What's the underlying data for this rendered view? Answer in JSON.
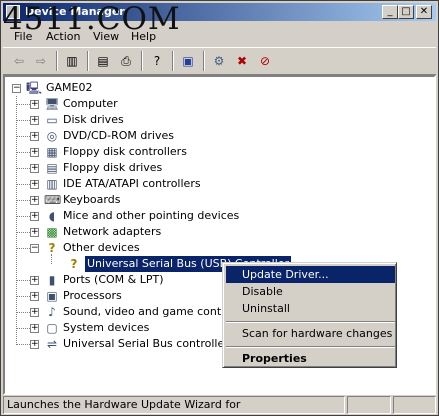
{
  "window": {
    "title": "Device Manager"
  },
  "watermark": "4511.COM",
  "menu": [
    "File",
    "Action",
    "View",
    "Help"
  ],
  "toolbar_icons": [
    "back-arrow-icon",
    "forward-arrow-icon",
    "show-hide-console-tree-icon",
    "properties-icon",
    "print-icon",
    "help-icon",
    "display-devices-icon",
    "scan-hardware-icon",
    "uninstall-icon",
    "disable-icon"
  ],
  "tree": {
    "root": "GAME02",
    "nodes": [
      {
        "label": "Computer",
        "icon": "computer-icon"
      },
      {
        "label": "Disk drives",
        "icon": "disk-drive-icon"
      },
      {
        "label": "DVD/CD-ROM drives",
        "icon": "cdrom-icon"
      },
      {
        "label": "Floppy disk controllers",
        "icon": "floppy-controller-icon"
      },
      {
        "label": "Floppy disk drives",
        "icon": "floppy-drive-icon"
      },
      {
        "label": "IDE ATA/ATAPI controllers",
        "icon": "ide-controller-icon"
      },
      {
        "label": "Keyboards",
        "icon": "keyboard-icon"
      },
      {
        "label": "Mice and other pointing devices",
        "icon": "mouse-icon"
      },
      {
        "label": "Network adapters",
        "icon": "network-adapter-icon"
      },
      {
        "label": "Other devices",
        "icon": "other-devices-icon",
        "expanded": true
      },
      {
        "label": "Universal Serial Bus (USB) Controller",
        "icon": "unknown-device-icon",
        "child": true,
        "selected": true
      },
      {
        "label": "Ports (COM & LPT)",
        "icon": "port-icon"
      },
      {
        "label": "Processors",
        "icon": "processor-icon"
      },
      {
        "label": "Sound, video and game controllers",
        "icon": "sound-icon"
      },
      {
        "label": "System devices",
        "icon": "system-devices-icon"
      },
      {
        "label": "Universal Serial Bus controllers",
        "icon": "usb-icon"
      }
    ]
  },
  "context_menu": {
    "items": [
      {
        "label": "Update Driver...",
        "highlighted": true
      },
      {
        "label": "Disable"
      },
      {
        "label": "Uninstall"
      },
      {
        "label": "Scan for hardware changes"
      },
      {
        "label": "Properties",
        "bold": true
      }
    ]
  },
  "status": {
    "text": "Launches the Hardware Update Wizard for"
  },
  "colors": {
    "titlebar_start": "#0a246a",
    "titlebar_end": "#a6caf0",
    "selection": "#0a246a",
    "face": "#d4d0c8"
  }
}
